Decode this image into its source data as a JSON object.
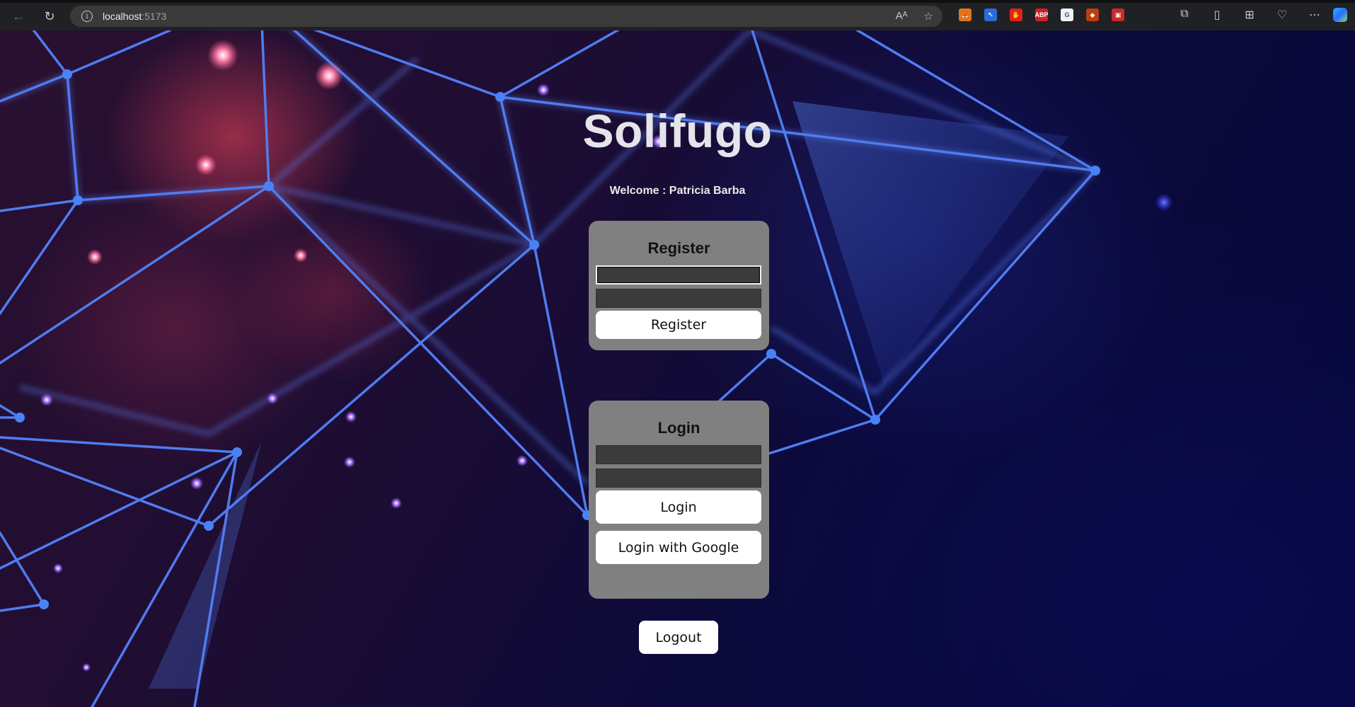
{
  "browser": {
    "url_host": "localhost",
    "url_port": ":5173",
    "extensions": [
      {
        "name": "metamask-extension-icon",
        "color": "#e2761b",
        "glyph": "🦊"
      },
      {
        "name": "cursor-extension-icon",
        "color": "#2b6cd9",
        "glyph": "↖"
      },
      {
        "name": "stop-extension-icon",
        "color": "#e0231a",
        "glyph": "✋"
      },
      {
        "name": "adblock-plus-icon",
        "color": "#d11f26",
        "glyph": "ABP"
      },
      {
        "name": "grammar-extension-icon",
        "color": "#f1f1f1",
        "glyph": "G"
      },
      {
        "name": "fox-extension-icon",
        "color": "#b8400d",
        "glyph": "◆"
      },
      {
        "name": "puzzle-red-extension-icon",
        "color": "#c92a2a",
        "glyph": "▣"
      }
    ]
  },
  "app": {
    "title": "Solifugo",
    "welcome": "Welcome : Patricia Barba"
  },
  "register": {
    "heading": "Register",
    "email_value": "",
    "password_value": "",
    "button_label": "Register"
  },
  "login": {
    "heading": "Login",
    "email_value": "",
    "password_value": "",
    "button_label": "Login",
    "google_label": "Login with Google"
  },
  "logout": {
    "label": "Logout"
  }
}
